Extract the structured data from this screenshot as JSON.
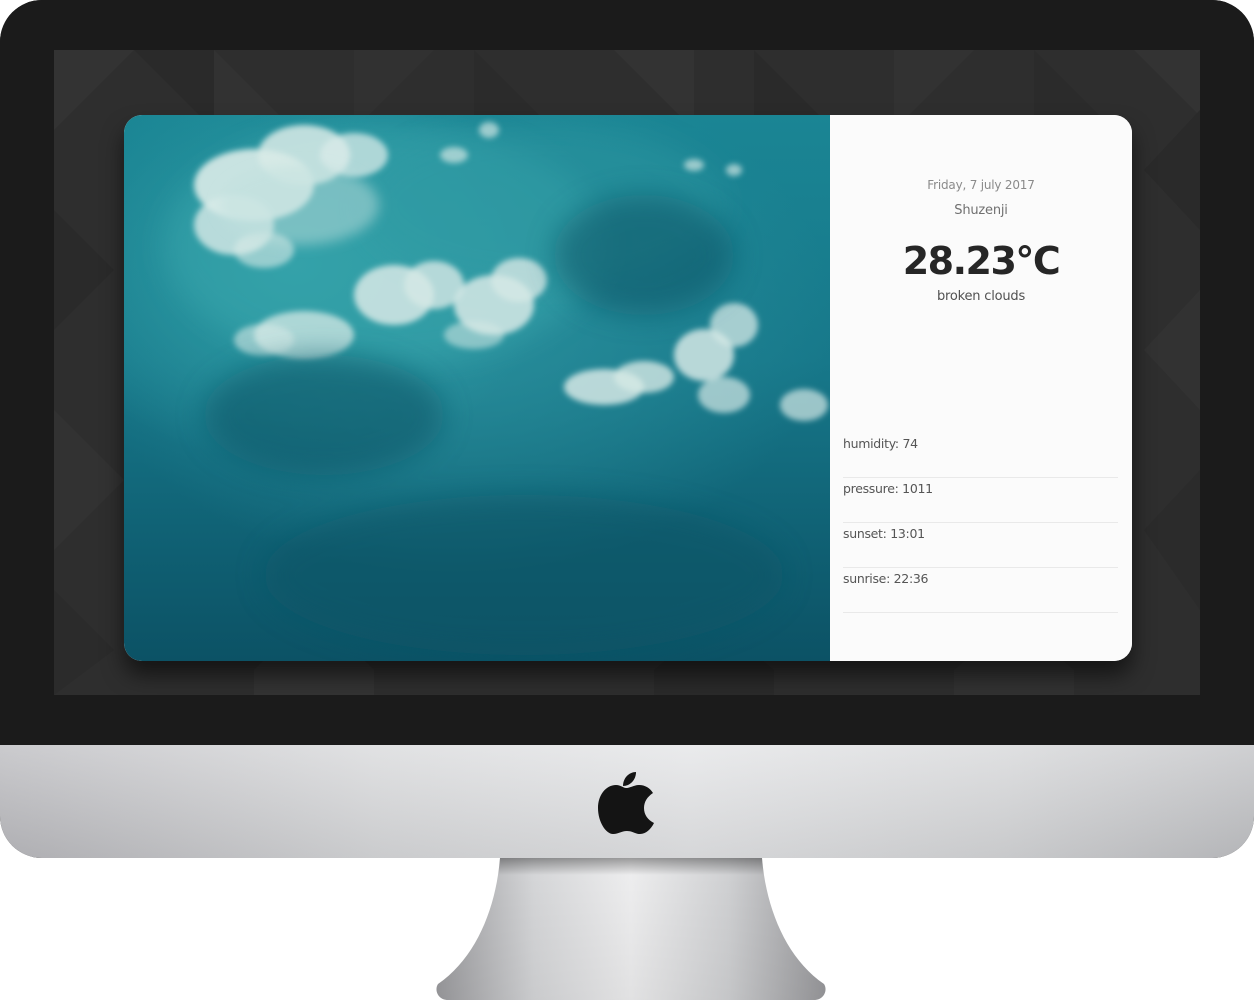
{
  "weather": {
    "date": "Friday, 7 july 2017",
    "city": "Shuzenji",
    "temperature": "28.23°C",
    "description": "broken clouds",
    "stats": [
      {
        "label": "humidity: 74"
      },
      {
        "label": "pressure: 1011"
      },
      {
        "label": "sunset: 13:01"
      },
      {
        "label": "sunrise: 22:36"
      }
    ]
  },
  "icons": {
    "brand_logo": "apple-logo-icon"
  },
  "colors": {
    "sky": "#17788a",
    "panel": "#fbfbfb",
    "bezel": "#1b1b1b",
    "screen_bg": "#2d2d2d",
    "text_dark": "#262626"
  }
}
